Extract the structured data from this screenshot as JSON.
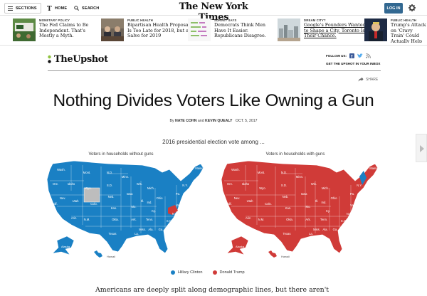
{
  "nav": {
    "sections": "SECTIONS",
    "home": "HOME",
    "search": "SEARCH",
    "masthead": "The New York Times",
    "login": "LOG IN"
  },
  "ribbon": [
    {
      "kicker": "MONETARY POLICY",
      "headline": "The Fed Claims to Be Independent. That's Mostly a Myth.",
      "thumb": "green"
    },
    {
      "kicker": "PUBLIC HEALTH",
      "headline": "Bipartisan Health Proposal Is Too Late for 2018, but a Salve for 2019",
      "thumb": "hearing"
    },
    {
      "kicker": "SURVEY SAYS",
      "headline": "Democrats Think Men Have It Easier. Republicans Disagree.",
      "thumb": "chart"
    },
    {
      "kicker": "DREAM CITY?",
      "headline": "Google's Founders Wanted to Shape a City. Toronto Is Their Chance.",
      "thumb": "city"
    },
    {
      "kicker": "PUBLIC HEALTH",
      "headline": "Trump's Attack on 'Cravy Train' Could Actually Help L...",
      "thumb": "trump"
    }
  ],
  "upshot": {
    "logo": "TheUpshot",
    "follow": "FOLLOW US:",
    "signup": "GET THE UPSHOT IN YOUR INBOX",
    "share": "SHARE"
  },
  "article": {
    "headline": "Nothing Divides Voters Like Owning a Gun",
    "by": "By",
    "author1": "NATE COHN",
    "and": "and",
    "author2": "KEVIN QUEALY",
    "date": "OCT. 5, 2017",
    "lede": "Americans are deeply split along demographic lines, but there aren't"
  },
  "graphic": {
    "title": "2016 presidential election vote among ...",
    "left_label": "Voters in households without guns",
    "right_label": "Voters in households with guns",
    "legend": [
      {
        "label": "Hillary Clinton",
        "color": "#1a80c4"
      },
      {
        "label": "Donald Trump",
        "color": "#d03b38"
      }
    ],
    "state_labels": [
      "Wash.",
      "Ore.",
      "Calif.",
      "Idaho",
      "Nev.",
      "Utah",
      "Ariz.",
      "Mont.",
      "Wyo.",
      "Colo.",
      "N.M.",
      "N.D.",
      "S.D.",
      "Neb.",
      "Kan.",
      "Okla.",
      "Texas",
      "Minn.",
      "Iowa",
      "Mo.",
      "Ark.",
      "La.",
      "Wis.",
      "Ill.",
      "Mich.",
      "Ind.",
      "Ohio",
      "Ky.",
      "Tenn.",
      "Miss.",
      "Ala.",
      "Ga.",
      "Fla.",
      "S.C.",
      "N.C.",
      "Va.",
      "Pa.",
      "N.Y.",
      "Maine",
      "Alaska",
      "Hawaii"
    ],
    "colors": {
      "clinton": "#1a80c4",
      "trump": "#d03b38",
      "no_data": "#bdbdbd"
    }
  }
}
